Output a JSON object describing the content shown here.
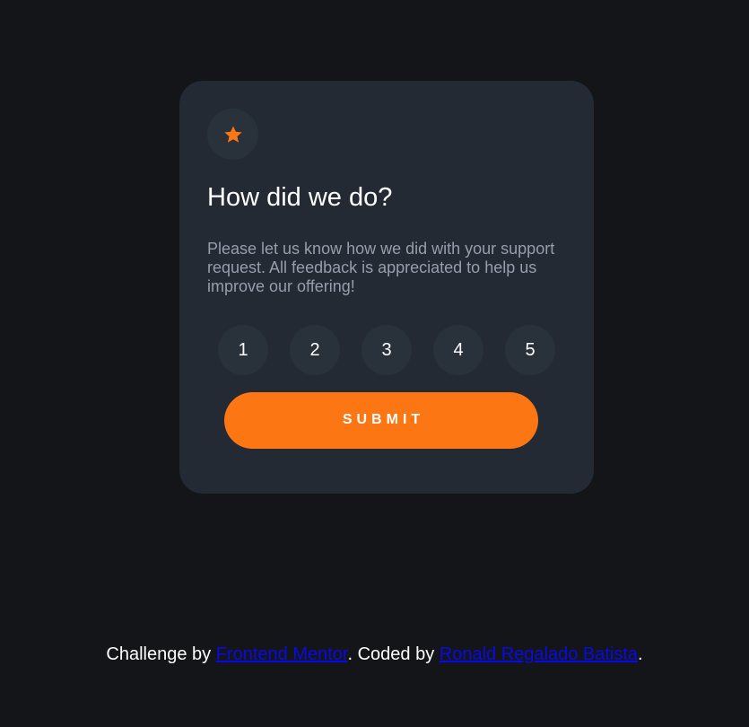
{
  "card": {
    "icon": "star-icon",
    "title": "How did we do?",
    "description": "Please let us know how we did with your support request. All feedback is appreciated to help us improve our offering!",
    "ratings": [
      "1",
      "2",
      "3",
      "4",
      "5"
    ],
    "submit_label": "SUBMIT"
  },
  "attribution": {
    "prefix": "Challenge by ",
    "challenge_link": "Frontend Mentor",
    "middle": ". Coded by ",
    "author_link": "Ronald Regalado Batista",
    "suffix": "."
  },
  "colors": {
    "background": "#131518",
    "card": "#232a34",
    "accent": "#fc7614",
    "circle": "#29313b",
    "muted_text": "#959eac",
    "link": "#0a0ae6"
  }
}
